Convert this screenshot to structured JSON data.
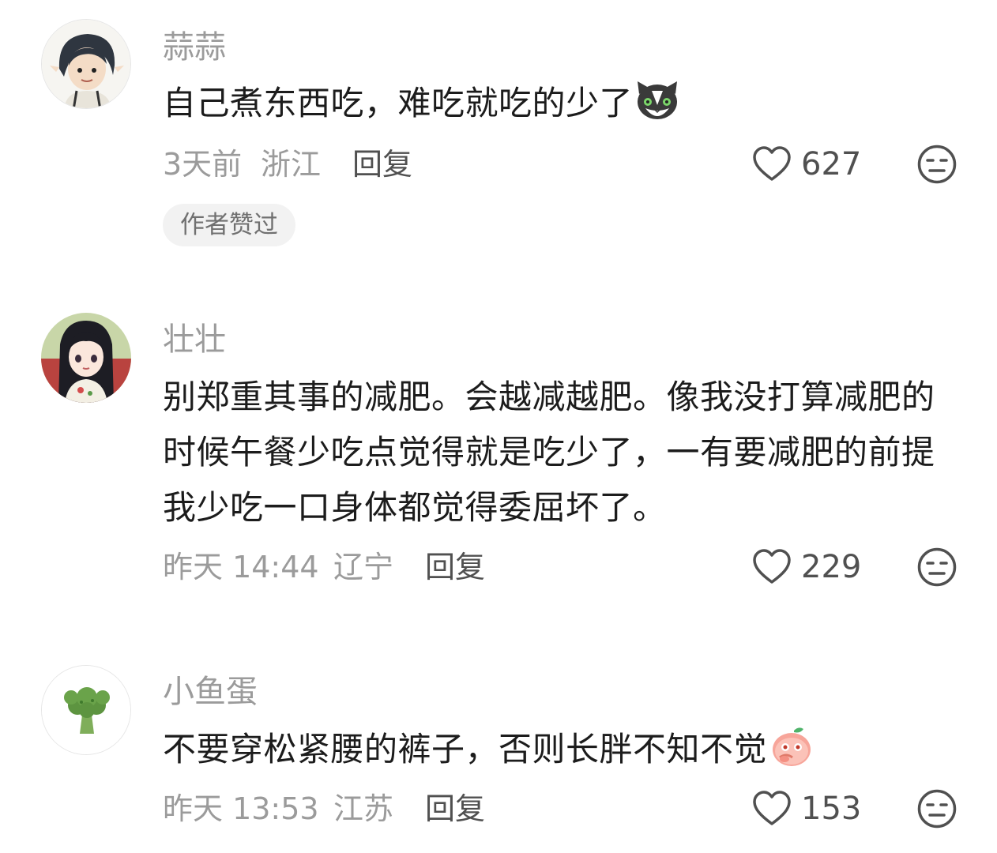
{
  "comments": [
    {
      "username": "蒜蒜",
      "text": "自己煮东西吃，难吃就吃的少了",
      "emoji": "cat-emoji",
      "time": "3天前",
      "location": "浙江",
      "reply_label": "回复",
      "likes": "627",
      "badge": "作者赞过"
    },
    {
      "username": "壮壮",
      "text": "别郑重其事的减肥。会越减越肥。像我没打算减肥的时候午餐少吃点觉得就是吃少了，一有要减肥的前提 我少吃一口身体都觉得委屈坏了。",
      "time": "昨天 14:44",
      "location": "辽宁",
      "reply_label": "回复",
      "likes": "229"
    },
    {
      "username": "小鱼蛋",
      "text": "不要穿松紧腰的裤子，否则长胖不知不觉",
      "emoji": "peach-emoji",
      "time": "昨天 13:53",
      "location": "江苏",
      "reply_label": "回复",
      "likes": "153"
    }
  ],
  "colors": {
    "username": "#9b9b9b",
    "body": "#1c1c1c",
    "meta": "#9b9b9b",
    "action": "#505050",
    "badge_bg": "#f2f2f2"
  },
  "icons": {
    "like": "heart-outline-icon",
    "dislike": "meh-face-icon"
  }
}
